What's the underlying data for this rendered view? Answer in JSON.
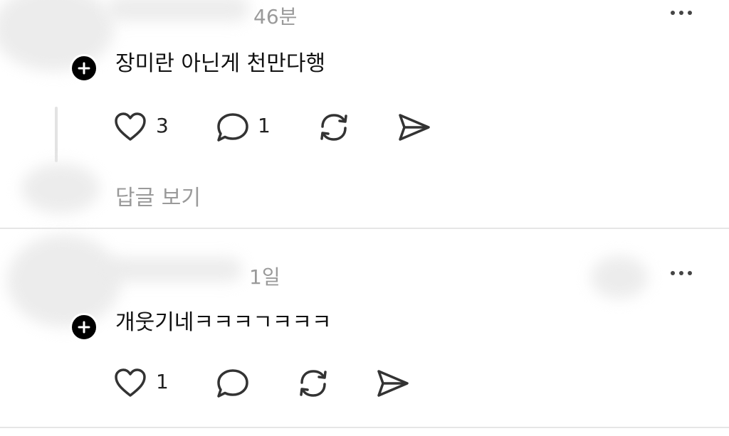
{
  "comments": [
    {
      "time": "46분",
      "text": "장미란 아닌게 천만다행",
      "likes": "3",
      "replies": "1",
      "view_replies": "답글 보기"
    },
    {
      "time": "1일",
      "text": "개웃기네ㅋㅋㅋㄱㅋㅋㅋ",
      "likes": "1"
    }
  ],
  "icons": [
    "heart-icon",
    "comment-icon",
    "repost-icon",
    "send-icon",
    "more-icon",
    "plus-icon"
  ]
}
